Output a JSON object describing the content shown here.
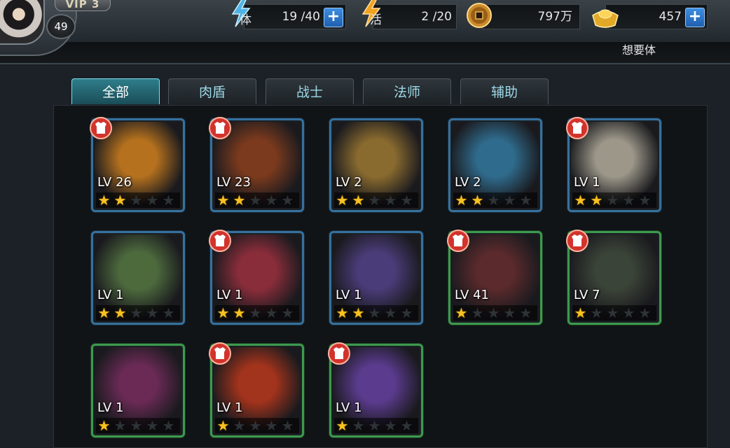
{
  "player": {
    "vip_label": "VIP 3",
    "level": "49"
  },
  "resources": {
    "stamina": {
      "icon": "stamina-lightning-icon",
      "sub": "体",
      "value": "19 /40"
    },
    "activity": {
      "icon": "activity-lightning-icon",
      "sub": "活",
      "value": "2 /20"
    },
    "coins": {
      "icon": "copper-coin-icon",
      "value": "797万"
    },
    "gold": {
      "icon": "gold-ingot-icon",
      "value": "457"
    }
  },
  "want_text": "想要体",
  "tabs": [
    "全部",
    "肉盾",
    "战士",
    "法师",
    "辅助"
  ],
  "active_tab": 0,
  "colors": {
    "accent_tab": "#2e7d8a",
    "blue_frame": "#35719e",
    "green_frame": "#3d9a4e",
    "star": "#f7c220",
    "plus_button": "#2a78cc"
  },
  "heroes": [
    {
      "level": "LV 26",
      "stars": 2,
      "frame": "blue",
      "armor": true,
      "portrait": "monk-king-portrait",
      "hue": "#b5711e"
    },
    {
      "level": "LV 23",
      "stars": 2,
      "frame": "blue",
      "armor": true,
      "portrait": "fire-demon-portrait",
      "hue": "#7b3a1d"
    },
    {
      "level": "LV 2",
      "stars": 2,
      "frame": "blue",
      "armor": false,
      "portrait": "lion-beast-portrait",
      "hue": "#8a6b2f"
    },
    {
      "level": "LV 2",
      "stars": 2,
      "frame": "blue",
      "armor": false,
      "portrait": "sea-dragon-portrait",
      "hue": "#2f6b8c"
    },
    {
      "level": "LV 1",
      "stars": 2,
      "frame": "blue",
      "armor": true,
      "portrait": "white-elephant-portrait",
      "hue": "#9c9789"
    },
    {
      "level": "LV 1",
      "stars": 2,
      "frame": "blue",
      "armor": false,
      "portrait": "old-sage-portrait",
      "hue": "#4d6a3d"
    },
    {
      "level": "LV 1",
      "stars": 2,
      "frame": "blue",
      "armor": true,
      "portrait": "red-hair-warrior-portrait",
      "hue": "#8a2d3a"
    },
    {
      "level": "LV 1",
      "stars": 2,
      "frame": "blue",
      "armor": false,
      "portrait": "purple-demon-portrait",
      "hue": "#4a3c78"
    },
    {
      "level": "LV 41",
      "stars": 1,
      "frame": "green",
      "armor": true,
      "portrait": "lady-warrior-portrait",
      "hue": "#5a2a2c"
    },
    {
      "level": "LV 7",
      "stars": 1,
      "frame": "green",
      "armor": true,
      "portrait": "dark-ogre-portrait",
      "hue": "#3b4438"
    },
    {
      "level": "LV 1",
      "stars": 1,
      "frame": "green",
      "armor": false,
      "portrait": "ghost-maiden-portrait",
      "hue": "#6a2a55"
    },
    {
      "level": "LV 1",
      "stars": 1,
      "frame": "green",
      "armor": true,
      "portrait": "red-lion-portrait",
      "hue": "#a2331c"
    },
    {
      "level": "LV 1",
      "stars": 1,
      "frame": "green",
      "armor": true,
      "portrait": "white-ninja-portrait",
      "hue": "#5b3b8e"
    }
  ]
}
